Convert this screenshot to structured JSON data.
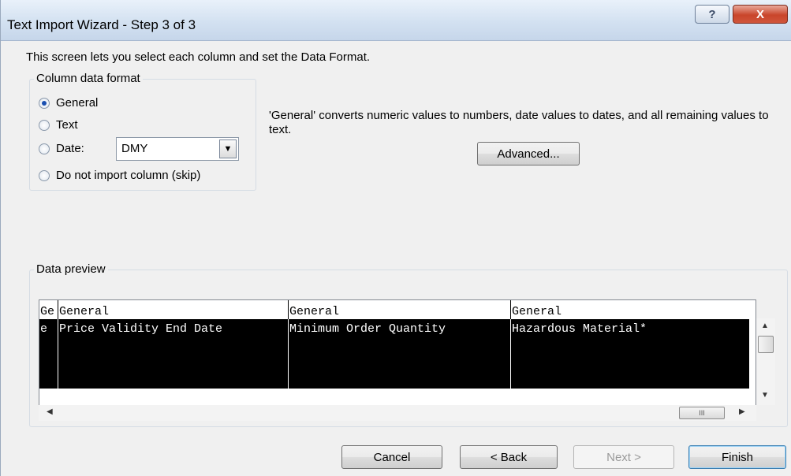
{
  "window": {
    "title": "Text Import Wizard - Step 3 of 3",
    "help_glyph": "?",
    "close_glyph": "X"
  },
  "intro_text": "This screen lets you select each column and set the Data Format.",
  "column_format": {
    "legend": "Column data format",
    "options": [
      {
        "label": "General",
        "checked": true
      },
      {
        "label": "Text",
        "checked": false
      },
      {
        "label": "Date:",
        "checked": false
      },
      {
        "label": "Do not import column (skip)",
        "checked": false
      }
    ],
    "date_value": "DMY",
    "date_dropdown_glyph": "▼"
  },
  "description": "'General' converts numeric values to numbers, date values to dates, and all remaining values to text.",
  "advanced_button": "Advanced...",
  "preview": {
    "legend": "Data preview",
    "headers": [
      "Ge",
      "General",
      "General",
      "General"
    ],
    "rows": [
      [
        "e",
        "Price Validity End Date",
        "Minimum Order Quantity",
        "Hazardous Material*"
      ]
    ],
    "scroll_up_glyph": "▲",
    "scroll_down_glyph": "▼",
    "scroll_left_glyph": "◀",
    "scroll_right_glyph": "▶",
    "thumb_grip": "III"
  },
  "buttons": {
    "cancel": "Cancel",
    "back": "< Back",
    "next": "Next >",
    "finish": "Finish"
  }
}
